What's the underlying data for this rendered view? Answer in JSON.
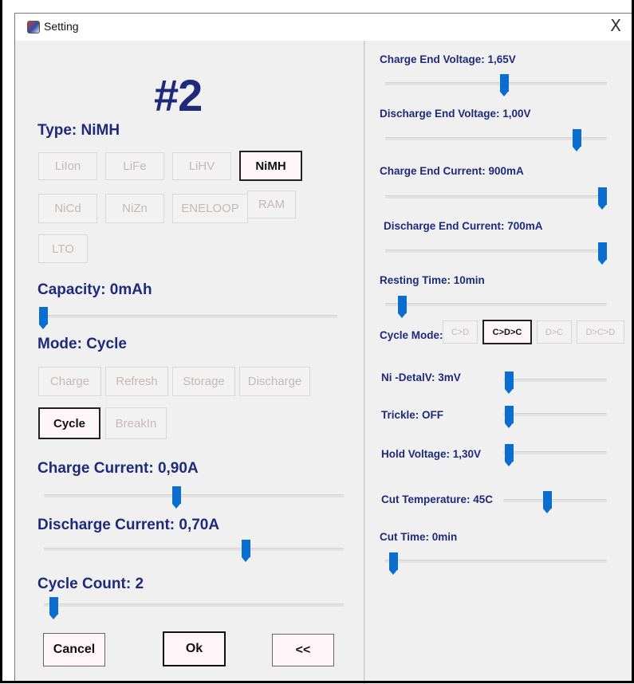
{
  "window": {
    "title": "Setting",
    "close_label": "X"
  },
  "slot": {
    "title": "#2"
  },
  "type": {
    "label": "Type:  NiMH",
    "options": [
      {
        "label": "LiIon",
        "selected": false
      },
      {
        "label": "LiFe",
        "selected": false
      },
      {
        "label": "LiHV",
        "selected": false
      },
      {
        "label": "NiMH",
        "selected": true
      },
      {
        "label": "NiCd",
        "selected": false
      },
      {
        "label": "NiZn",
        "selected": false
      },
      {
        "label": "ENELOOP",
        "selected": false
      },
      {
        "label": "RAM",
        "selected": false
      },
      {
        "label": "LTO",
        "selected": false
      }
    ]
  },
  "capacity": {
    "label": "Capacity:  0mAh",
    "value": 0
  },
  "mode": {
    "label": "Mode:  Cycle",
    "options": [
      {
        "label": "Charge",
        "selected": false
      },
      {
        "label": "Refresh",
        "selected": false
      },
      {
        "label": "Storage",
        "selected": false
      },
      {
        "label": "Discharge",
        "selected": false
      },
      {
        "label": "Cycle",
        "selected": true
      },
      {
        "label": "BreakIn",
        "selected": false
      }
    ]
  },
  "charge_current": {
    "label": "Charge Current:  0,90A",
    "value": 0.44
  },
  "discharge_current": {
    "label": "Discharge Current:  0,70A",
    "value": 0.68
  },
  "cycle_count": {
    "label": "Cycle Count:  2",
    "value": 0.02
  },
  "buttons": {
    "cancel": "Cancel",
    "ok": "Ok",
    "back": "<<"
  },
  "right": {
    "charge_end_voltage": {
      "label": "Charge End Voltage:  1,65V",
      "value": 0.54
    },
    "discharge_end_voltage": {
      "label": "Discharge End Voltage:  1,00V",
      "value": 0.88
    },
    "charge_end_current": {
      "label": "Charge End Current:  900mA",
      "value": 1.0
    },
    "discharge_end_current": {
      "label": "Discharge End Current:  700mA",
      "value": 1.0
    },
    "resting_time": {
      "label": "Resting Time:  10min",
      "value": 0.06
    },
    "cycle_mode": {
      "label": "Cycle Mode:",
      "options": [
        {
          "label": "C>D",
          "selected": false
        },
        {
          "label": "C>D>C",
          "selected": true
        },
        {
          "label": "D>C",
          "selected": false
        },
        {
          "label": "D>C>D",
          "selected": false
        }
      ]
    },
    "ni_delta_v": {
      "label": "Ni -DetalV:  3mV",
      "value": 0.02
    },
    "trickle": {
      "label": "Trickle:  OFF",
      "value": 0.02
    },
    "hold_voltage": {
      "label": "Hold Voltage:  1,30V",
      "value": 0.02
    },
    "cut_temperature": {
      "label": "Cut Temperature:  45C",
      "value": 0.42
    },
    "cut_time": {
      "label": "Cut Time:  0min",
      "value": 0.02
    }
  },
  "colors": {
    "accent": "#0a6ed1",
    "label": "#1f2a7a",
    "disabled_text": "#c9b6b6",
    "window_bg": "#f0f0f0"
  }
}
